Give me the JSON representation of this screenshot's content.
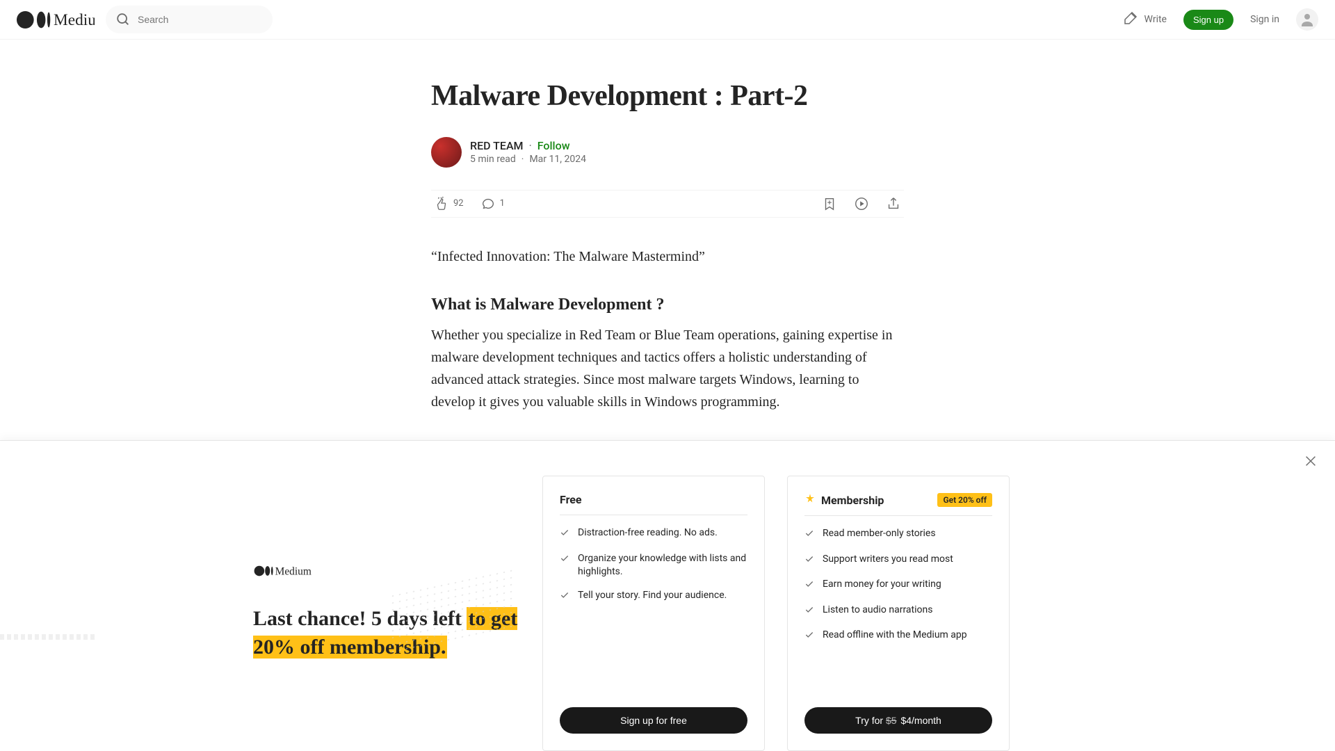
{
  "nav": {
    "search_placeholder": "Search",
    "write_label": "Write",
    "signup_label": "Sign up",
    "signin_label": "Sign in"
  },
  "article": {
    "title": "Malware Development : Part-2",
    "author": "RED TEAM",
    "follow_label": "Follow",
    "read_time": "5 min read",
    "date": "Mar 11, 2024",
    "claps": "92",
    "responses": "1",
    "lead_quote": "“Infected Innovation: The Malware Mastermind”",
    "section_heading": "What is Malware Development ?",
    "body": "Whether you specialize in Red Team or Blue Team operations, gaining expertise in malware development techniques and tactics offers a holistic understanding of advanced attack strategies. Since most malware targets Windows, learning to develop it gives you valuable skills in Windows programming."
  },
  "banner": {
    "headline_plain": "Last chance! 5 days left ",
    "headline_highlight": "to get 20% off membership.",
    "free": {
      "title": "Free",
      "features": [
        "Distraction-free reading. No ads.",
        "Organize your knowledge with lists and highlights.",
        "Tell your story. Find your audience."
      ],
      "cta": "Sign up for free"
    },
    "membership": {
      "title": "Membership",
      "badge": "Get 20% off",
      "features": [
        "Read member-only stories",
        "Support writers you read most",
        "Earn money for your writing",
        "Listen to audio narrations",
        "Read offline with the Medium app"
      ],
      "cta_prefix": "Try for ",
      "cta_strike": "$5",
      "cta_rest": " $4/month"
    }
  }
}
